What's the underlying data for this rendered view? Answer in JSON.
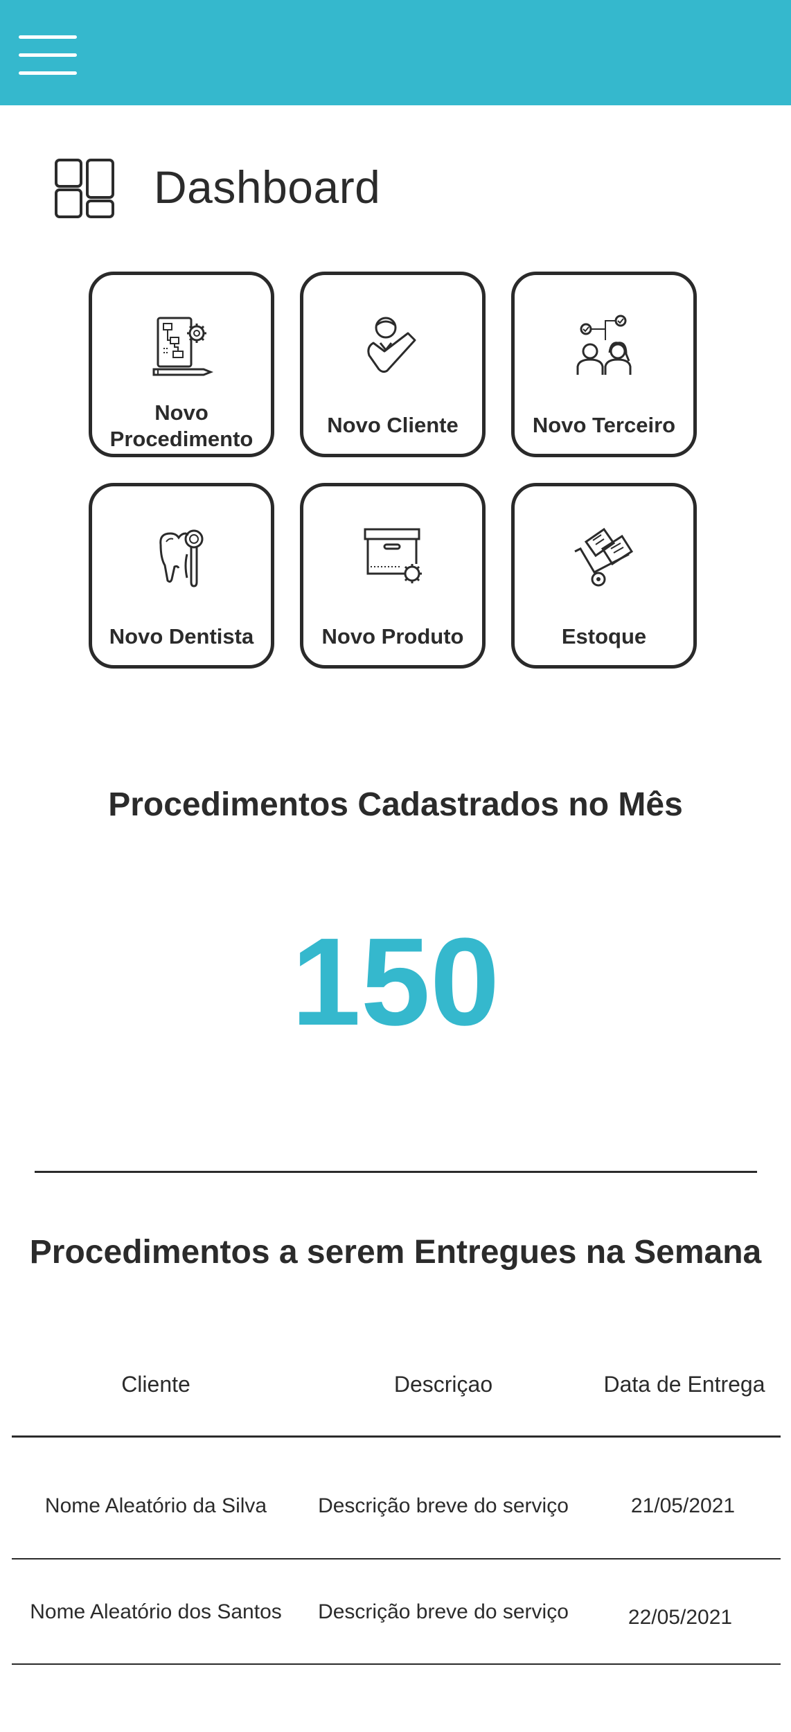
{
  "header": {
    "menu_icon": "hamburger-menu-icon",
    "accent_color": "#35b8cd"
  },
  "dashboard": {
    "title": "Dashboard",
    "icon": "dashboard-grid-icon"
  },
  "tiles": [
    {
      "label_line1": "Novo",
      "label_line2": "Procedimento",
      "icon": "flowchart-gear-icon"
    },
    {
      "label": "Novo Cliente",
      "icon": "user-check-icon"
    },
    {
      "label": "Novo Terceiro",
      "icon": "people-checklist-icon"
    },
    {
      "label": "Novo Dentista",
      "icon": "tooth-mirror-icon"
    },
    {
      "label": "Novo Produto",
      "icon": "product-box-icon"
    },
    {
      "label": "Estoque",
      "icon": "hand-truck-icon"
    }
  ],
  "monthly": {
    "title": "Procedimentos Cadastrados no Mês",
    "value": "150"
  },
  "weekly": {
    "title": "Procedimentos a serem Entregues na Semana",
    "columns": [
      "Cliente",
      "Descriçao",
      "Data de Entrega"
    ],
    "rows": [
      {
        "cliente": "Nome Aleatório da Silva",
        "descricao": "Descrição breve do serviço",
        "data": "21/05/2021"
      },
      {
        "cliente": "Nome Aleatório dos Santos",
        "descricao": "Descrição breve do serviço",
        "data": "22/05/2021"
      }
    ]
  }
}
